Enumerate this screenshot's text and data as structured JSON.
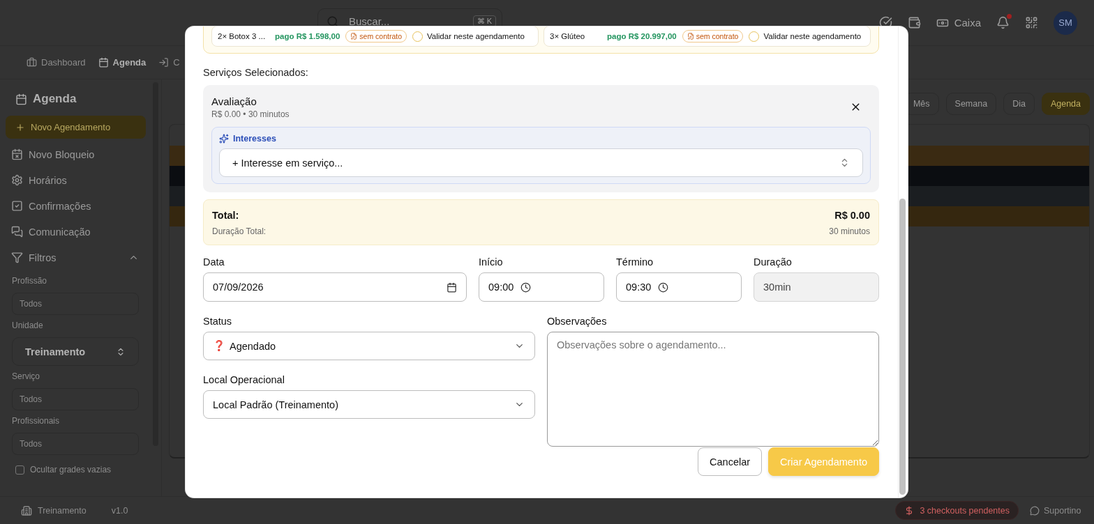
{
  "header": {
    "search": {
      "placeholder": "Buscar...",
      "shortcut": "⌘ K"
    },
    "cash_button": "Caixa",
    "has_unread": true,
    "avatar": "SM"
  },
  "nav": [
    {
      "label": "Dashboard",
      "selected": false,
      "kind": "dashboard"
    },
    {
      "label": "Agenda",
      "selected": true,
      "kind": "calendar"
    },
    {
      "label": "C",
      "selected": false,
      "kind": "login"
    }
  ],
  "sidebar": {
    "title": "Agenda",
    "new_button": "Novo Agendamento",
    "items": [
      {
        "label": "Novo Bloqueio",
        "kind": "block"
      },
      {
        "label": "Horários",
        "kind": "settings"
      },
      {
        "label": "Confirmações",
        "kind": "confirm"
      },
      {
        "label": "Comunicação",
        "kind": "chat"
      }
    ],
    "filters": {
      "label": "Filtros",
      "expanded": true,
      "fields": [
        {
          "label": "Profissão",
          "placeholder": "Todos",
          "kind": "input"
        },
        {
          "label": "Unidade",
          "value": "Treinamento",
          "kind": "select"
        },
        {
          "label": "Serviço",
          "placeholder": "Todos",
          "kind": "input"
        },
        {
          "label": "Profissionais",
          "placeholder": "Todos",
          "kind": "input"
        }
      ]
    },
    "hide_empty": {
      "label": "Ocultar grades vazias",
      "checked": false
    }
  },
  "views": [
    {
      "label": "Mês",
      "selected": false
    },
    {
      "label": "Semana",
      "selected": false
    },
    {
      "label": "Dia",
      "selected": false
    },
    {
      "label": "Agenda",
      "selected": true
    }
  ],
  "calendar_rows": [
    {
      "color": "#3a2a12"
    },
    {
      "color": "#0b0d11"
    },
    {
      "color": "#1b1e21"
    },
    {
      "color": "#35270f"
    }
  ],
  "footer": {
    "unit": "Treinamento",
    "version": "v1.0",
    "checkouts": "3 checkouts pendentes",
    "support": "Suportino"
  },
  "modal": {
    "packages": [
      {
        "name": "2× Botox 3 ...",
        "paid": "pago R$ 1.598,00",
        "contract": "sem contrato",
        "validate": {
          "label": "Validar neste agendamento",
          "checked": false
        }
      },
      {
        "name": "3× Glúteo",
        "paid": "pago R$ 20.997,00",
        "contract": "sem contrato",
        "validate": {
          "label": "Validar neste agendamento",
          "checked": false
        }
      }
    ],
    "section_title": "Serviços Selecionados:",
    "service": {
      "name": "Avaliação",
      "meta": "R$ 0.00 • 30 minutos",
      "interests": {
        "label": "Interesses",
        "select": "+ Interesse em serviço..."
      }
    },
    "totals": {
      "total_label": "Total:",
      "total_value": "R$ 0.00",
      "duration_label": "Duração Total:",
      "duration_value": "30 minutos"
    },
    "fields": [
      {
        "label": "Data",
        "value": "07/09/2026",
        "kind": "date"
      },
      {
        "label": "Início",
        "value": "09:00",
        "kind": "time"
      },
      {
        "label": "Término",
        "value": "09:30",
        "kind": "time"
      },
      {
        "label": "Duração",
        "value": "30min",
        "kind": "readonly"
      }
    ],
    "status": {
      "label": "Status",
      "icon": "❓",
      "value": "Agendado"
    },
    "location": {
      "label": "Local Operacional",
      "value": "Local Padrão (Treinamento)"
    },
    "notes": {
      "label": "Observações",
      "placeholder": "Observações sobre o agendamento..."
    },
    "actions": [
      {
        "label": "Cancelar",
        "kind": "secondary"
      },
      {
        "label": "Criar Agendamento",
        "kind": "primary"
      }
    ]
  }
}
